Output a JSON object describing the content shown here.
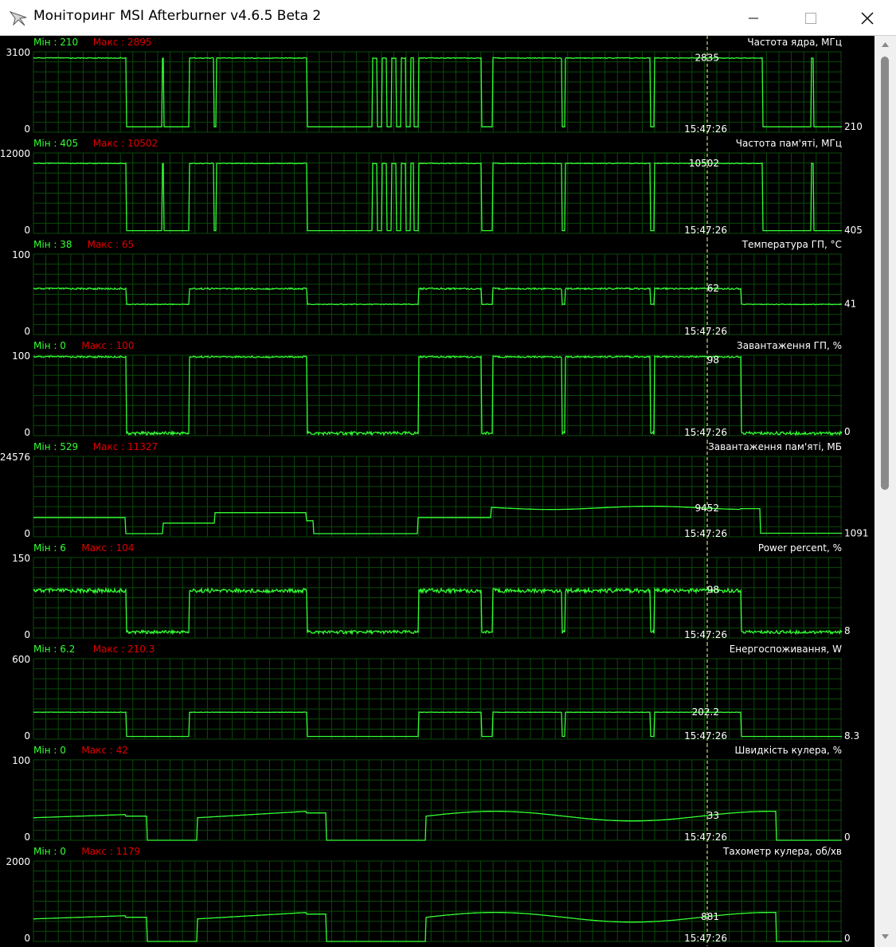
{
  "window": {
    "title": "Моніторинг MSI Afterburner v4.6.5 Beta 2",
    "icon": "afterburner-plane-icon"
  },
  "colors": {
    "line": "#33ff33",
    "min_text": "#33ff33",
    "max_text": "#e00000",
    "grid": "#0a4a0a",
    "cursor": "#ffff99",
    "label_text": "#ffffff"
  },
  "cursor_time": "15:47:26",
  "graphs": [
    {
      "title": "Частота ядра, МГц",
      "min_label": "Мін : 210",
      "max_label": "Макс : 2895",
      "y_max": "3100",
      "y_min": "0",
      "current": "2835",
      "right_value": "210",
      "ymax_num": 3100,
      "profile": "clock",
      "hi": 2875,
      "lo": 210,
      "end": 210
    },
    {
      "title": "Частота пам'яті, МГц",
      "min_label": "Мін : 405",
      "max_label": "Макс : 10502",
      "y_max": "12000",
      "y_min": "0",
      "current": "10502",
      "right_value": "405",
      "ymax_num": 12000,
      "profile": "clock",
      "hi": 10502,
      "lo": 405,
      "end": 405
    },
    {
      "title": "Температура ГП, °C",
      "min_label": "Мін : 38",
      "max_label": "Макс : 65",
      "y_max": "100",
      "y_min": "0",
      "current": "62",
      "right_value": "41",
      "ymax_num": 100,
      "profile": "temp",
      "hi": 62,
      "lo": 41,
      "end": 41
    },
    {
      "title": "Завантаження ГП, %",
      "min_label": "Мін : 0",
      "max_label": "Макс : 100",
      "y_max": "100",
      "y_min": "0",
      "current": "98",
      "right_value": "0",
      "ymax_num": 100,
      "profile": "load",
      "hi": 99,
      "lo": 1,
      "end": 0
    },
    {
      "title": "Завантаження пам'яті, МБ",
      "min_label": "Мін : 529",
      "max_label": "Макс : 11327",
      "y_max": "24576",
      "y_min": "0",
      "current": "9452",
      "right_value": "1091",
      "ymax_num": 24576,
      "profile": "mem",
      "hi": 9452,
      "lo": 1091,
      "end": 1091
    },
    {
      "title": "Power percent, %",
      "min_label": "Мін : 6",
      "max_label": "Макс : 104",
      "y_max": "150",
      "y_min": "0",
      "current": "98",
      "right_value": "8",
      "ymax_num": 150,
      "profile": "power",
      "hi": 92,
      "lo": 8,
      "end": 8
    },
    {
      "title": "Енергоспоживання, W",
      "min_label": "Мін : 6.2",
      "max_label": "Макс : 210.3",
      "y_max": "600",
      "y_min": "0",
      "current": "202.2",
      "right_value": "8.3",
      "ymax_num": 600,
      "profile": "watt",
      "hi": 202,
      "lo": 8.3,
      "end": 8.3
    },
    {
      "title": "Швидкість кулера, %",
      "min_label": "Мін : 0",
      "max_label": "Макс : 42",
      "y_max": "100",
      "y_min": "0",
      "current": "33",
      "right_value": "0",
      "ymax_num": 100,
      "profile": "fan",
      "hi": 33,
      "lo": 0,
      "end": 0
    },
    {
      "title": "Тахометр кулера, об/хв",
      "min_label": "Мін : 0",
      "max_label": "Макс : 1179",
      "y_max": "2000",
      "y_min": "0",
      "current": "881",
      "right_value": "0",
      "ymax_num": 2000,
      "profile": "fan",
      "hi": 881,
      "lo": 0,
      "end": 0
    }
  ]
}
